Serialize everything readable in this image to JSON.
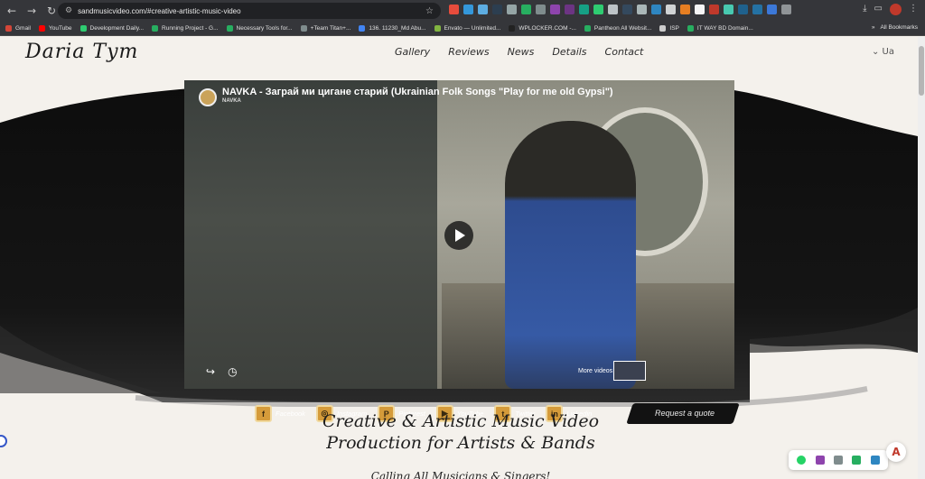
{
  "browser": {
    "url": "sandmusicvideo.com/#creative-artistic-music-video",
    "bookmarks": [
      {
        "label": "Gmail",
        "color": "#d44638"
      },
      {
        "label": "YouTube",
        "color": "#ff0000"
      },
      {
        "label": "Development Daily...",
        "color": "#2ecc71"
      },
      {
        "label": "Running Project - G...",
        "color": "#27ae60"
      },
      {
        "label": "Necessary Tools for...",
        "color": "#27ae60"
      },
      {
        "label": "+Team Titan+...",
        "color": "#7f8c8d"
      },
      {
        "label": "136. 11230_Md Abu...",
        "color": "#4285f4"
      },
      {
        "label": "Envato — Unlimited...",
        "color": "#82b541"
      },
      {
        "label": "WPLOCKER.COM -...",
        "color": "#222222"
      },
      {
        "label": "Pantheon All Websit...",
        "color": "#27ae60"
      },
      {
        "label": "ISP",
        "color": "#cccccc"
      },
      {
        "label": "IT WAY BD Domain...",
        "color": "#27ae60"
      }
    ],
    "all_bookmarks": "All Bookmarks",
    "overflow": "»"
  },
  "site": {
    "logo": "Daria Tym",
    "menu": [
      "Gallery",
      "Reviews",
      "News",
      "Details",
      "Contact"
    ],
    "lang": "⌄ Ua"
  },
  "video": {
    "title": "NAVKA - Заграй ми цигане старий (Ukrainian Folk Songs \"Play for me old Gypsi\")",
    "channel": "NAVKA",
    "more_videos": "More videos",
    "share_icon": "share-icon",
    "watch_later_icon": "clock-icon"
  },
  "socials": [
    {
      "label": "Facebook",
      "glyph": "f"
    },
    {
      "label": "Instagram",
      "glyph": "◎"
    },
    {
      "label": "Pinterest",
      "glyph": "P"
    },
    {
      "label": "YouTube",
      "glyph": "▶"
    },
    {
      "label": "Twitter",
      "glyph": "t"
    },
    {
      "label": "Linkedin",
      "glyph": "in"
    }
  ],
  "cta": {
    "quote": "Request a quote"
  },
  "content": {
    "headline_1": "Creative & Artistic Music Video",
    "headline_2": "Production for Artists & Bands",
    "subline": "Calling All Musicians & Singers!"
  },
  "floating": {
    "pdf": "A"
  }
}
